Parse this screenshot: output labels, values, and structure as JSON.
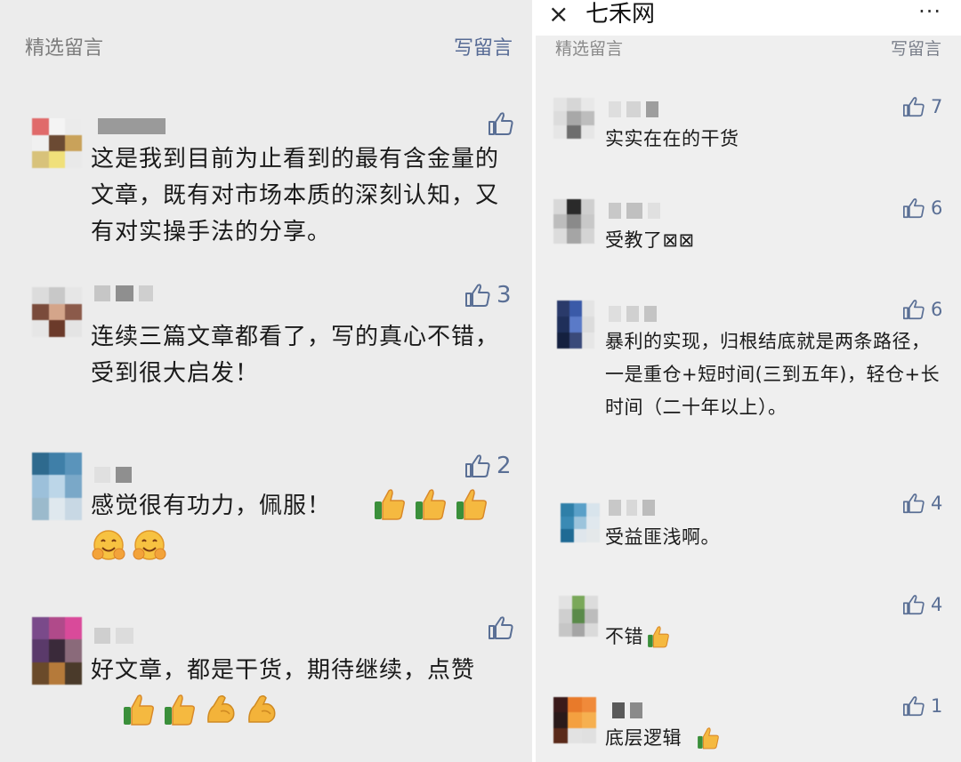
{
  "left": {
    "section_title": "精选留言",
    "write_label": "写留言",
    "comments": [
      {
        "likes": "",
        "text": "这是我到目前为止看到的最有含金量的文章，既有对市场本质的深刻认知，又有对实操手法的分享。"
      },
      {
        "likes": "3",
        "text": "连续三篇文章都看了，写的真心不错，受到很大启发！"
      },
      {
        "likes": "2",
        "text": "感觉很有功力，佩服！",
        "emojis": [
          "thumbs-up",
          "thumbs-up",
          "thumbs-up",
          "smiling-face-with-hands",
          "smiling-face-with-hands"
        ]
      },
      {
        "likes": "",
        "text": "好文章，都是干货，期待继续，点赞",
        "emojis": [
          "thumbs-up",
          "thumbs-up",
          "flexed-biceps",
          "flexed-biceps"
        ]
      }
    ]
  },
  "right": {
    "topbar": {
      "close": "×",
      "title": "七禾网",
      "more": "···"
    },
    "section_title": "精选留言",
    "write_label": "写留言",
    "comments": [
      {
        "likes": "7",
        "text": "实实在在的干货"
      },
      {
        "likes": "6",
        "text": "受教了⊠⊠"
      },
      {
        "likes": "6",
        "text": "暴利的实现，归根结底就是两条路径，一是重仓+短时间(三到五年)，轻仓+长时间（二十年以上）。"
      },
      {
        "likes": "4",
        "text": "受益匪浅啊。"
      },
      {
        "likes": "4",
        "text": "不错",
        "emojis": [
          "thumbs-up"
        ]
      },
      {
        "likes": "1",
        "text": "底层逻辑",
        "emojis": [
          "thumbs-up"
        ]
      }
    ]
  },
  "colors": {
    "link": "#576b95",
    "like": "#5a6f95",
    "text": "#1a1a1a",
    "muted": "#7c7c7c",
    "bg": "#ececec"
  }
}
